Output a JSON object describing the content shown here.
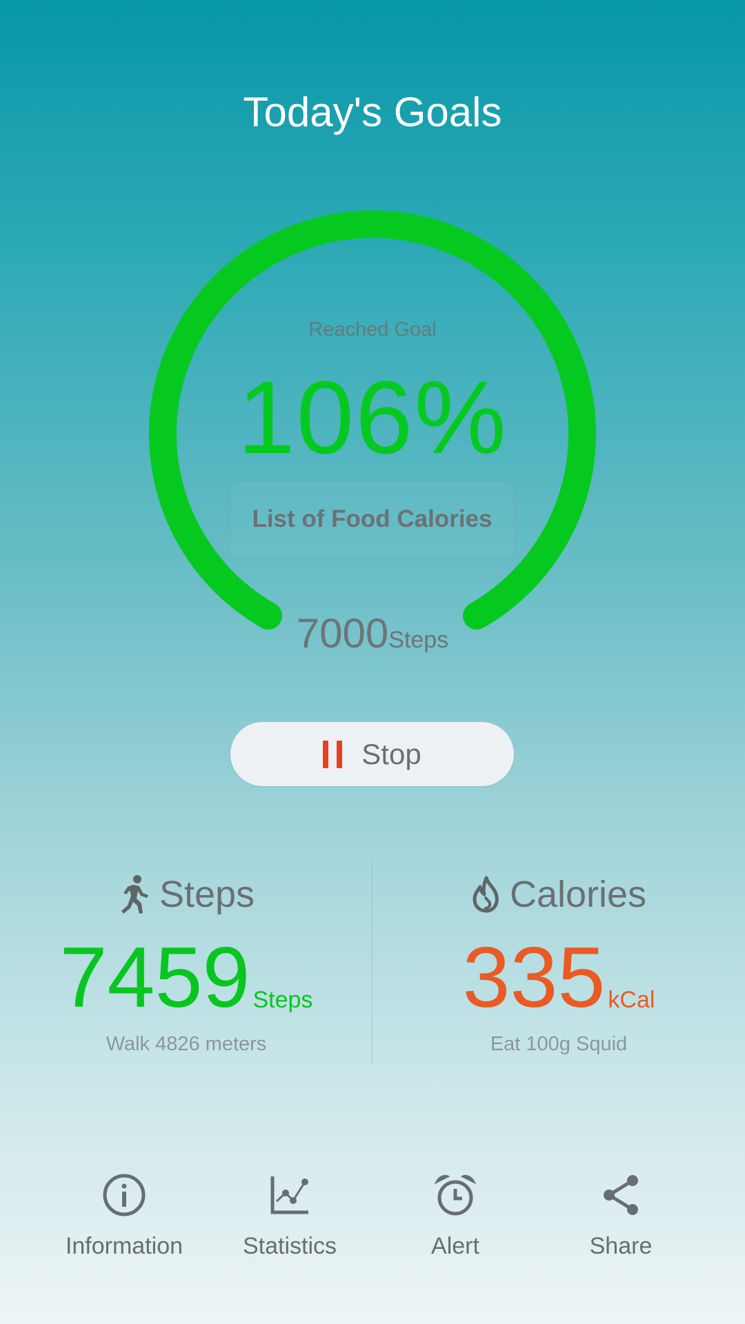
{
  "header": {
    "title": "Today's Goals"
  },
  "goal_ring": {
    "label": "Reached Goal",
    "percent_text": "106%",
    "progress_fraction": 1.0,
    "food_button_label": "List of Food Calories",
    "goal_value": "7000",
    "goal_unit": "Steps",
    "ring_color": "#06c91f"
  },
  "control": {
    "stop_label": "Stop",
    "pause_icon": "pause-icon",
    "pause_color": "#e8401f"
  },
  "stats": {
    "steps": {
      "title": "Steps",
      "icon": "walking-person-icon",
      "value": "7459",
      "unit": "Steps",
      "subtitle": "Walk 4826 meters",
      "color": "#08c61f"
    },
    "calories": {
      "title": "Calories",
      "icon": "flame-icon",
      "value": "335",
      "unit": "kCal",
      "subtitle": "Eat 100g Squid",
      "color": "#ea5a25"
    }
  },
  "bottom_nav": {
    "items": [
      {
        "label": "Information",
        "icon": "info-icon"
      },
      {
        "label": "Statistics",
        "icon": "statistics-icon"
      },
      {
        "label": "Alert",
        "icon": "alarm-clock-icon"
      },
      {
        "label": "Share",
        "icon": "share-icon"
      }
    ]
  }
}
